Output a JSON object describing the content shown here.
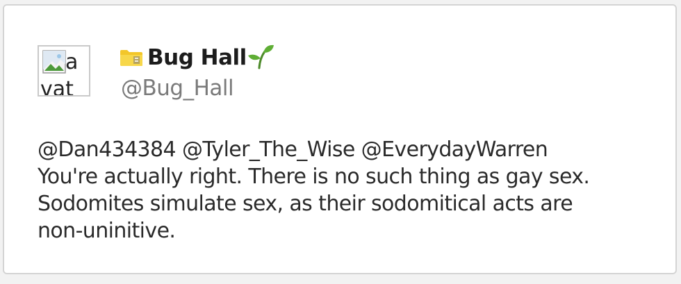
{
  "tweet": {
    "avatar": {
      "alt_line1": "a",
      "alt_line2": "vat",
      "icon": "broken-image-icon"
    },
    "author": {
      "display_name": "Bug Hall",
      "handle": "@Bug_Hall",
      "name_prefix_icon": "folder-emoji-icon",
      "name_suffix_icon": "sprout-emoji-icon"
    },
    "mentions": [
      "@Dan434384",
      "@Tyler_The_Wise",
      "@EverydayWarren"
    ],
    "body_lines": [
      "You're actually right. There is no such thing as gay sex.",
      "Sodomites simulate sex, as their sodomitical acts are",
      "non-uninitive."
    ]
  },
  "colors": {
    "text": "#2a2a2a",
    "handle": "#7a7a7a",
    "card_border": "#d4d4d4",
    "background": "#ffffff"
  }
}
